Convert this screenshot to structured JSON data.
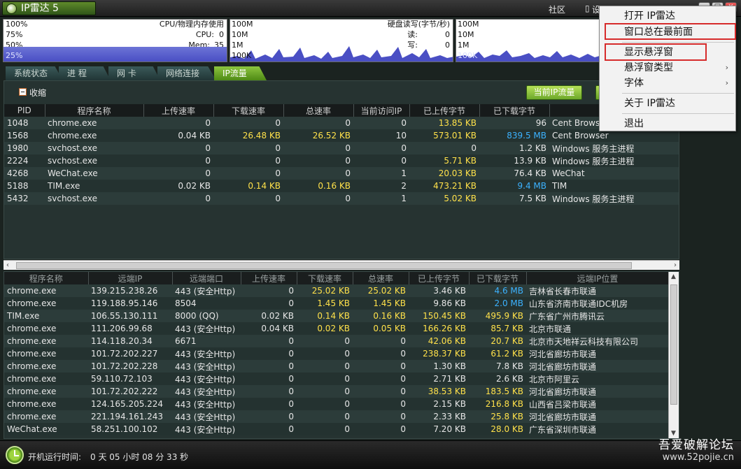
{
  "app": {
    "title": "IP雷达 5",
    "community": "社区",
    "settings": "设置",
    "min": "_",
    "max": "□",
    "close": "×"
  },
  "monitors": {
    "cpu": {
      "p100": "100%",
      "p75": "75%",
      "p50": "50%",
      "p25": "25%",
      "title": "CPU/物理内存使用",
      "cpu_label": "CPU:",
      "cpu_value": "0",
      "mem_label": "Mem:",
      "mem_value": "35"
    },
    "disk": {
      "s100m": "100M",
      "s10m": "10M",
      "s1m": "1M",
      "s100k": "100K",
      "title": "硬盘读写(字节/秒)",
      "read_label": "读:",
      "read_value": "0",
      "write_label": "写:",
      "write_value": "0"
    },
    "net": {
      "s100m": "100M",
      "s10m": "10M",
      "s1m": "1M",
      "s100k": "100K"
    }
  },
  "tabs": [
    "系统状态",
    "进 程",
    "网 卡",
    "网络连接",
    "IP流量"
  ],
  "toolbar": {
    "collapse_label": "收缩",
    "current_traffic": "当前IP流量"
  },
  "process_table": {
    "headers": [
      "PID",
      "程序名称",
      "上传速率",
      "下载速率",
      "总速率",
      "当前访问IP",
      "已上传字节",
      "已下载字节",
      ""
    ],
    "rows": [
      [
        "1048",
        "chrome.exe",
        "0",
        "0",
        "0",
        "0",
        "13.85 KB",
        "96",
        "Cent Browser"
      ],
      [
        "1568",
        "chrome.exe",
        "0.04 KB",
        "26.48 KB",
        "26.52 KB",
        "10",
        "573.01 KB",
        "839.5 MB",
        "Cent Browser"
      ],
      [
        "1980",
        "svchost.exe",
        "0",
        "0",
        "0",
        "0",
        "0",
        "1.2 KB",
        "Windows 服务主进程"
      ],
      [
        "2224",
        "svchost.exe",
        "0",
        "0",
        "0",
        "0",
        "5.71 KB",
        "13.9 KB",
        "Windows 服务主进程"
      ],
      [
        "4268",
        "WeChat.exe",
        "0",
        "0",
        "0",
        "1",
        "20.03 KB",
        "76.4 KB",
        "WeChat"
      ],
      [
        "5188",
        "TIM.exe",
        "0.02 KB",
        "0.14 KB",
        "0.16 KB",
        "2",
        "473.21 KB",
        "9.4 MB",
        "TIM"
      ],
      [
        "5432",
        "svchost.exe",
        "0",
        "0",
        "0",
        "1",
        "5.02 KB",
        "7.5 KB",
        "Windows 服务主进程"
      ]
    ]
  },
  "conn_table": {
    "headers": [
      "程序名称",
      "远端IP",
      "远端端口",
      "上传速率",
      "下载速率",
      "总速率",
      "已上传字节",
      "已下载字节",
      "远端IP位置"
    ],
    "rows": [
      [
        "chrome.exe",
        "139.215.238.26",
        "443 (安全Http)",
        "0",
        "25.02 KB",
        "25.02 KB",
        "3.46 KB",
        "4.6 MB",
        "吉林省长春市联通"
      ],
      [
        "chrome.exe",
        "119.188.95.146",
        "8504",
        "0",
        "1.45 KB",
        "1.45 KB",
        "9.86 KB",
        "2.0 MB",
        "山东省济南市联通IDC机房"
      ],
      [
        "TIM.exe",
        "106.55.130.111",
        "8000 (QQ)",
        "0.02 KB",
        "0.14 KB",
        "0.16 KB",
        "150.45 KB",
        "495.9 KB",
        "广东省广州市腾讯云"
      ],
      [
        "chrome.exe",
        "111.206.99.68",
        "443 (安全Http)",
        "0.04 KB",
        "0.02 KB",
        "0.05 KB",
        "166.26 KB",
        "85.7 KB",
        "北京市联通"
      ],
      [
        "chrome.exe",
        "114.118.20.34",
        "6671",
        "0",
        "0",
        "0",
        "42.06 KB",
        "20.7 KB",
        "北京市天地祥云科技有限公司"
      ],
      [
        "chrome.exe",
        "101.72.202.227",
        "443 (安全Http)",
        "0",
        "0",
        "0",
        "238.37 KB",
        "61.2 KB",
        "河北省廊坊市联通"
      ],
      [
        "chrome.exe",
        "101.72.202.228",
        "443 (安全Http)",
        "0",
        "0",
        "0",
        "1.30 KB",
        "7.8 KB",
        "河北省廊坊市联通"
      ],
      [
        "chrome.exe",
        "59.110.72.103",
        "443 (安全Http)",
        "0",
        "0",
        "0",
        "2.71 KB",
        "2.6 KB",
        "北京市阿里云"
      ],
      [
        "chrome.exe",
        "101.72.202.222",
        "443 (安全Http)",
        "0",
        "0",
        "0",
        "38.53 KB",
        "183.5 KB",
        "河北省廊坊市联通"
      ],
      [
        "chrome.exe",
        "124.165.205.224",
        "443 (安全Http)",
        "0",
        "0",
        "0",
        "2.15 KB",
        "216.8 KB",
        "山西省吕梁市联通"
      ],
      [
        "chrome.exe",
        "221.194.161.243",
        "443 (安全Http)",
        "0",
        "0",
        "0",
        "2.33 KB",
        "25.8 KB",
        "河北省廊坊市联通"
      ],
      [
        "WeChat.exe",
        "58.251.100.102",
        "443 (安全Http)",
        "0",
        "0",
        "0",
        "7.20 KB",
        "28.0 KB",
        "广东省深圳市联通"
      ]
    ]
  },
  "status": {
    "uptime_label": "开机运行时间:",
    "uptime_value": "0 天 05 小时 08 分 33 秒"
  },
  "watermark": {
    "line1": "吾爱破解论坛",
    "line2": "www.52pojie.cn"
  },
  "context_menu": {
    "items": [
      "打开 IP雷达",
      "窗口总在最前面",
      "显示悬浮窗",
      "悬浮窗类型",
      "字体",
      "关于 IP雷达",
      "退出"
    ],
    "submenu_arrow": "›"
  },
  "colors": {
    "accent_green": "#8dc53f",
    "highlight_yellow": "#ffe14a",
    "highlight_blue": "#3cb2ff",
    "graph_blue": "#4a4fc4",
    "menu_highlight_border": "#d62b2b"
  }
}
